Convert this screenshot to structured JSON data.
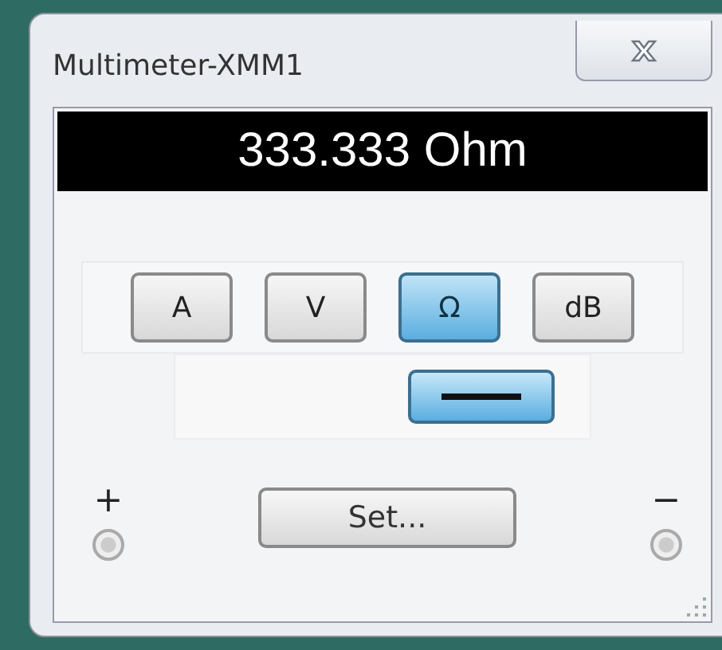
{
  "window": {
    "title": "Multimeter-XMM1"
  },
  "display": {
    "reading": "333.333 Ohm"
  },
  "mode_buttons": [
    {
      "label": "A",
      "selected": false
    },
    {
      "label": "V",
      "selected": false
    },
    {
      "label": "Ω",
      "selected": true
    },
    {
      "label": "dB",
      "selected": false
    }
  ],
  "signal_buttons": [
    {
      "kind": "dc",
      "selected": true
    }
  ],
  "terminals": [
    {
      "label": "+"
    },
    {
      "label": "−"
    }
  ],
  "set_button": {
    "label": "Set..."
  }
}
